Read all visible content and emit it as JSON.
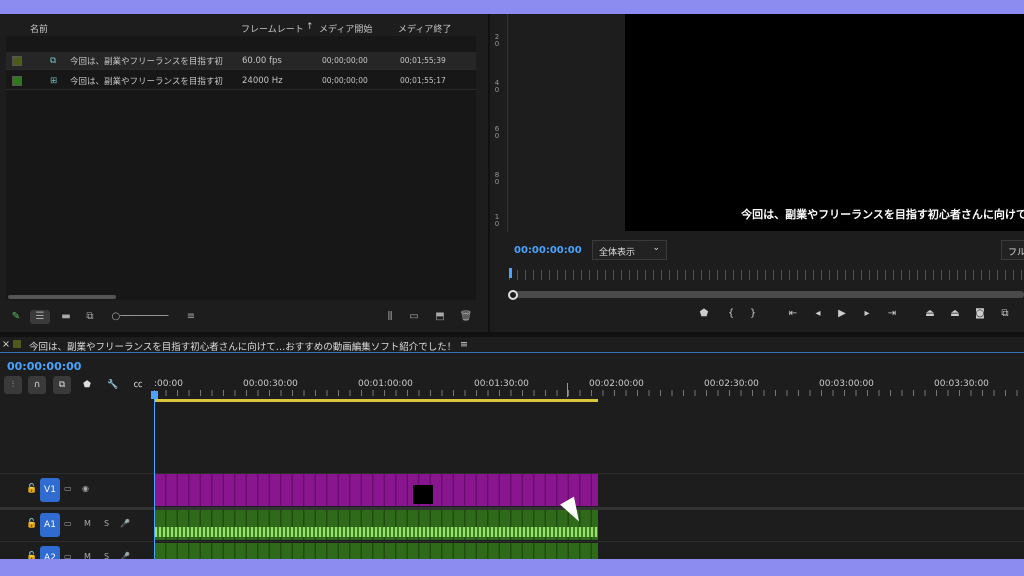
{
  "project": {
    "columns": {
      "name": "名前",
      "framerate": "フレームレート",
      "sort_arrow": "↑",
      "media_start": "メディア開始",
      "media_end": "メディア終了"
    },
    "rows": [
      {
        "name": "今回は、副業やフリーランスを目指す初",
        "framerate": "60.00 fps",
        "start": "00;00;00;00",
        "end": "00;01;55;39",
        "swatch": "#4c5a1a",
        "icon": "sequence-icon"
      },
      {
        "name": "今回は、副業やフリーランスを目指す初",
        "framerate": "24000 Hz",
        "start": "00;00;00;00",
        "end": "00;01;55;17",
        "swatch": "#2d7a1e",
        "icon": "audio-clip-icon"
      }
    ]
  },
  "program": {
    "ruler_labels": [
      "2\n0",
      "4\n0",
      "6\n0",
      "8\n0",
      "1\n0"
    ],
    "subtitle": "今回は、副業やフリーランスを目指す初心者さんに向けて",
    "timecode": "00:00:00:00",
    "zoom": "全体表示",
    "zoom_arrow": "⌄",
    "full": "フル"
  },
  "timeline": {
    "close": "×",
    "sequence_name": "今回は、副業やフリーランスを目指す初心者さんに向けて…おすすめの動画編集ソフト紹介でした！",
    "menu": "≡",
    "timecode": "00:00:00:00",
    "ruler": [
      ":00:00",
      "00:00:30:00",
      "00:01:00:00",
      "00:01:30:00",
      "00:02:00:00",
      "00:02:30:00",
      "00:03:00:00",
      "00:03:30:00"
    ],
    "tracks": [
      {
        "label": "V1"
      },
      {
        "label": "A1",
        "m": "M",
        "s": "S"
      },
      {
        "label": "A2",
        "m": "M",
        "s": "S"
      }
    ]
  },
  "colors": {
    "accent": "#4aa3ff",
    "video_clip": "#8a168f",
    "audio_clip": "#2f6a1a",
    "track_label": "#2f6bd0"
  }
}
